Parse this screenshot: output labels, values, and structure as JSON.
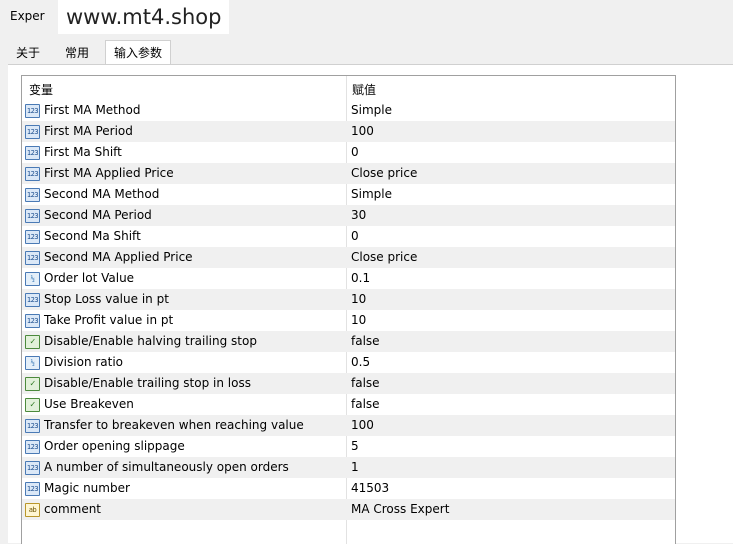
{
  "window": {
    "title": "Exper",
    "watermark": "www.mt4.shop"
  },
  "tabs": [
    {
      "label": "关于",
      "active": false
    },
    {
      "label": "常用",
      "active": false
    },
    {
      "label": "输入参数",
      "active": true
    }
  ],
  "table": {
    "headers": {
      "variable": "变量",
      "value": "赋值"
    },
    "rows": [
      {
        "icon": "123",
        "type": "int",
        "name": "First MA Method",
        "value": "Simple"
      },
      {
        "icon": "123",
        "type": "int",
        "name": "First MA Period",
        "value": "100"
      },
      {
        "icon": "123",
        "type": "int",
        "name": "First Ma Shift",
        "value": "0"
      },
      {
        "icon": "123",
        "type": "int",
        "name": "First MA Applied Price",
        "value": "Close price"
      },
      {
        "icon": "123",
        "type": "int",
        "name": "Second MA Method",
        "value": "Simple"
      },
      {
        "icon": "123",
        "type": "int",
        "name": "Second MA Period",
        "value": "30"
      },
      {
        "icon": "123",
        "type": "int",
        "name": "Second Ma Shift",
        "value": "0"
      },
      {
        "icon": "123",
        "type": "int",
        "name": "Second MA Applied Price",
        "value": "Close price"
      },
      {
        "icon": "½",
        "type": "double",
        "name": "Order lot Value",
        "value": "0.1"
      },
      {
        "icon": "123",
        "type": "int",
        "name": "Stop Loss value in pt",
        "value": "10"
      },
      {
        "icon": "123",
        "type": "int",
        "name": "Take Profit value in pt",
        "value": "10"
      },
      {
        "icon": "✓",
        "type": "bool",
        "name": "Disable/Enable halving trailing stop",
        "value": "false"
      },
      {
        "icon": "½",
        "type": "double",
        "name": "Division ratio",
        "value": "0.5"
      },
      {
        "icon": "✓",
        "type": "bool",
        "name": "Disable/Enable trailing stop in loss",
        "value": "false"
      },
      {
        "icon": "✓",
        "type": "bool",
        "name": "Use Breakeven",
        "value": "false"
      },
      {
        "icon": "123",
        "type": "int",
        "name": "Transfer to breakeven when reaching value",
        "value": "100"
      },
      {
        "icon": "123",
        "type": "int",
        "name": "Order opening slippage",
        "value": "5"
      },
      {
        "icon": "123",
        "type": "int",
        "name": "A number of simultaneously open orders",
        "value": "1"
      },
      {
        "icon": "123",
        "type": "int",
        "name": "Magic number",
        "value": "41503"
      },
      {
        "icon": "ab",
        "type": "string",
        "name": "comment",
        "value": "MA Cross Expert"
      }
    ]
  }
}
